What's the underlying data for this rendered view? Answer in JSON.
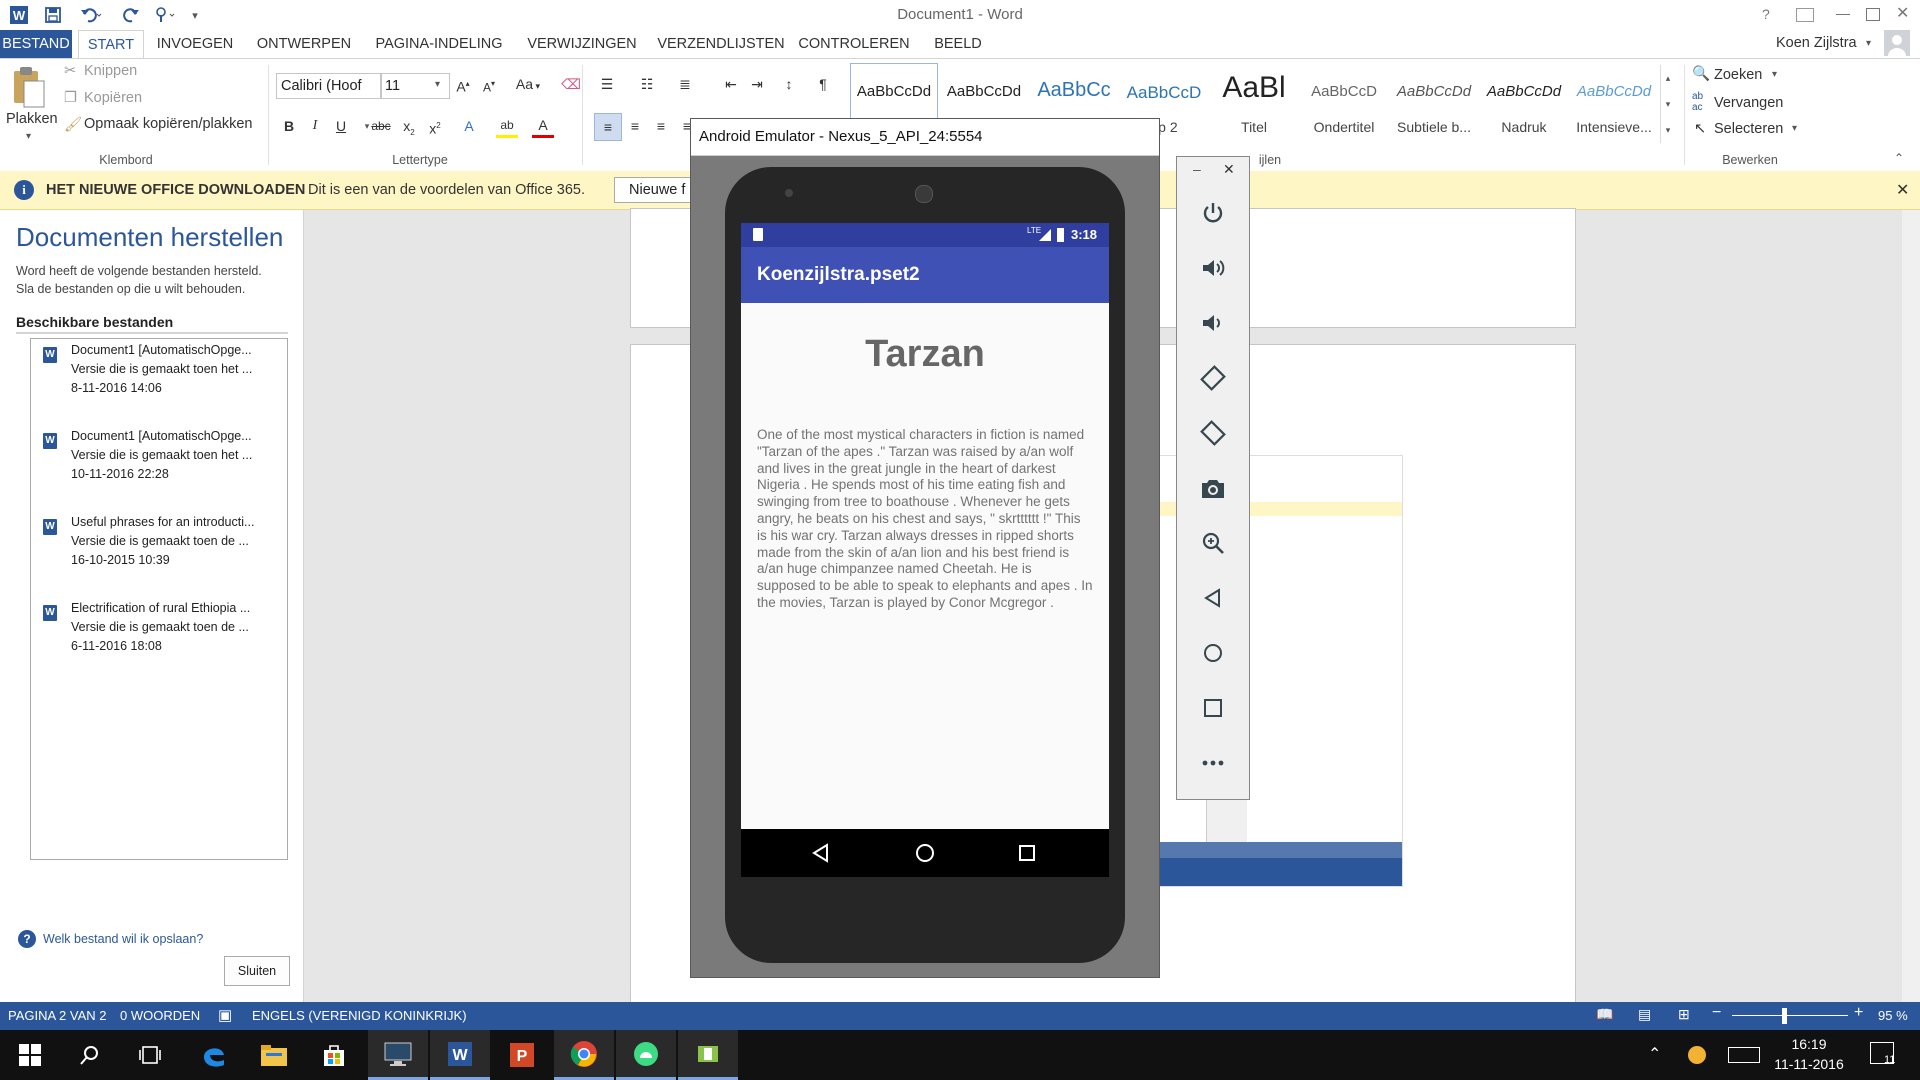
{
  "window": {
    "title": "Document1 - Word",
    "help": "?",
    "user": "Koen Zijlstra"
  },
  "ribbon_tabs": [
    "BESTAND",
    "START",
    "INVOEGEN",
    "ONTWERPEN",
    "PAGINA-INDELING",
    "VERWIJZINGEN",
    "VERZENDLIJSTEN",
    "CONTROLEREN",
    "BEELD"
  ],
  "clipboard": {
    "paste": "Plakken",
    "cut": "Knippen",
    "copy": "Kopiëren",
    "format_painter": "Opmaak kopiëren/plakken",
    "group": "Klembord"
  },
  "font": {
    "family": "Calibri (Hoof",
    "size": "11",
    "group": "Lettertype",
    "case": "Aa"
  },
  "paragraph": {
    "pilcrow": "¶"
  },
  "styles": [
    {
      "sample": "AaBbCcDd",
      "name": ""
    },
    {
      "sample": "AaBbCcDd",
      "name": ""
    },
    {
      "sample": "AaBbCc",
      "name": ""
    },
    {
      "sample": "AaBbCcD",
      "name": "op 2"
    },
    {
      "sample": "AaBl",
      "name": "Titel"
    },
    {
      "sample": "AaBbCcD",
      "name": "Ondertitel"
    },
    {
      "sample": "AaBbCcDd",
      "name": "Subtiele b..."
    },
    {
      "sample": "AaBbCcDd",
      "name": "Nadruk"
    },
    {
      "sample": "AaBbCcDd",
      "name": "Intensieve..."
    }
  ],
  "styles_group": "ijlen",
  "editing": {
    "find": "Zoeken",
    "replace": "Vervangen",
    "select": "Selecteren",
    "group": "Bewerken"
  },
  "infobar": {
    "title": "HET NIEUWE OFFICE DOWNLOADEN",
    "text": "Dit is een van de voordelen van Office 365.",
    "button": "Nieuwe f"
  },
  "recovery": {
    "title": "Documenten herstellen",
    "desc1": "Word heeft de volgende bestanden hersteld.",
    "desc2": "Sla de bestanden op die u wilt behouden.",
    "available": "Beschikbare bestanden",
    "files": [
      {
        "name": "Document1  [AutomatischOpge...",
        "desc": "Versie die is gemaakt toen het ...",
        "date": "8-11-2016 14:06"
      },
      {
        "name": "Document1  [AutomatischOpge...",
        "desc": "Versie die is gemaakt toen het ...",
        "date": "10-11-2016 22:28"
      },
      {
        "name": "Useful phrases for an introducti...",
        "desc": "Versie die is gemaakt toen de ...",
        "date": "16-10-2015 10:39"
      },
      {
        "name": "Electrification of rural Ethiopia ...",
        "desc": "Versie die is gemaakt toen de ...",
        "date": "6-11-2016 18:08"
      }
    ],
    "help_link": "Welk bestand wil ik opslaan?",
    "close_button": "Sluiten"
  },
  "emulator": {
    "window_title": "Android Emulator - Nexus_5_API_24:5554",
    "status_time": "3:18",
    "status_network": "LTE",
    "app_title": "Koenzijlstra.pset2",
    "story_title": "Tarzan",
    "story_text": "One of the most mystical characters in fiction is named \"Tarzan of the apes .\" Tarzan was raised by a/an wolf and lives in the great jungle in the heart of darkest Nigeria . He spends most of his time eating fish and swinging from tree to boathouse . Whenever he gets angry, he beats on his chest and says, \" skrtttttt !\" This is his war cry. Tarzan always dresses in ripped shorts made from the skin of a/an lion and his best friend is a/an huge chimpanzee named Cheetah. He is supposed to be able to speak to elephants and apes . In the movies, Tarzan is played by Conor Mcgregor ."
  },
  "statusbar": {
    "page": "PAGINA 2 VAN 2",
    "words": "0 WOORDEN",
    "language": "ENGELS (VERENIGD KONINKRIJK)",
    "zoom": "95 %"
  },
  "taskbar": {
    "time": "16:19",
    "date": "11-11-2016",
    "notifications": "11"
  },
  "colors": {
    "word_blue": "#2b579a",
    "android_primary": "#3f51b5",
    "android_dark": "#303f9f",
    "infobar": "#fff6c6"
  }
}
